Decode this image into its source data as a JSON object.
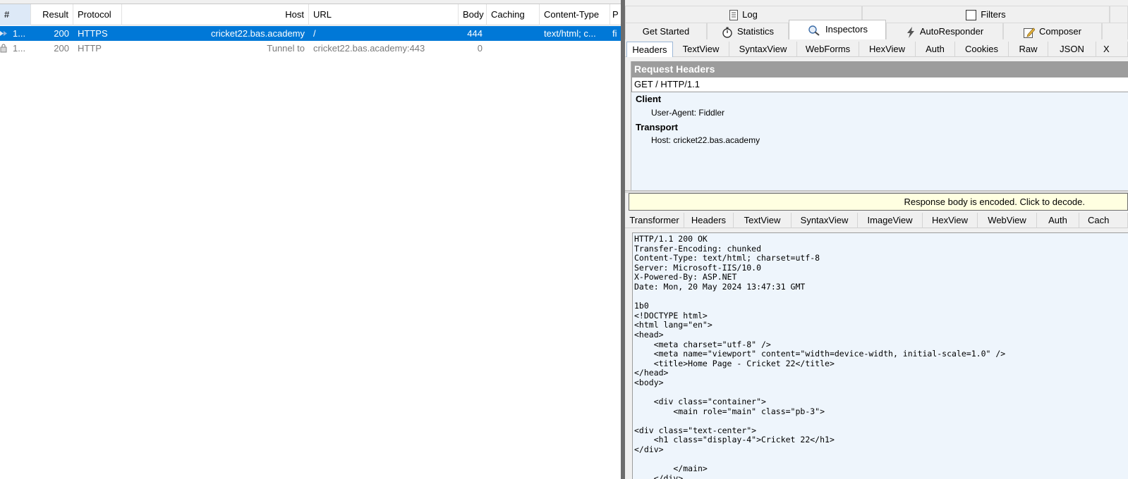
{
  "sessions": {
    "columns": [
      {
        "label": "#"
      },
      {
        "label": "Result"
      },
      {
        "label": "Protocol"
      },
      {
        "label": "Host"
      },
      {
        "label": "URL"
      },
      {
        "label": "Body"
      },
      {
        "label": "Caching"
      },
      {
        "label": "Content-Type"
      },
      {
        "label": "P"
      }
    ],
    "rows": [
      {
        "num": "1...",
        "result": "200",
        "protocol": "HTTPS",
        "host": "cricket22.bas.academy",
        "url": "/",
        "body": "444",
        "caching": "",
        "content_type": "text/html; c...",
        "process": "fi",
        "selected": true
      },
      {
        "num": "1...",
        "result": "200",
        "protocol": "HTTP",
        "host": "Tunnel to",
        "url": "cricket22.bas.academy:443",
        "body": "0",
        "caching": "",
        "content_type": "",
        "process": "",
        "selected": false
      }
    ]
  },
  "top_tabs": {
    "log": "Log",
    "filters": "Filters",
    "get_started": "Get Started",
    "statistics": "Statistics",
    "inspectors": "Inspectors",
    "autoresponder": "AutoResponder",
    "composer": "Composer"
  },
  "request_tabs": [
    "Headers",
    "TextView",
    "SyntaxView",
    "WebForms",
    "HexView",
    "Auth",
    "Cookies",
    "Raw",
    "JSON",
    "X"
  ],
  "request": {
    "title": "Request Headers",
    "request_line": "GET / HTTP/1.1",
    "groups": [
      {
        "name": "Client",
        "headers": [
          "User-Agent: Fiddler"
        ]
      },
      {
        "name": "Transport",
        "headers": [
          "Host: cricket22.bas.academy"
        ]
      }
    ]
  },
  "encoded_bar": "Response body is encoded. Click to decode.",
  "response_tabs": [
    "Transformer",
    "Headers",
    "TextView",
    "SyntaxView",
    "ImageView",
    "HexView",
    "WebView",
    "Auth",
    "Cach"
  ],
  "response_body": "HTTP/1.1 200 OK\nTransfer-Encoding: chunked\nContent-Type: text/html; charset=utf-8\nServer: Microsoft-IIS/10.0\nX-Powered-By: ASP.NET\nDate: Mon, 20 May 2024 13:47:31 GMT\n\n1b0\n<!DOCTYPE html>\n<html lang=\"en\">\n<head>\n    <meta charset=\"utf-8\" />\n    <meta name=\"viewport\" content=\"width=device-width, initial-scale=1.0\" />\n    <title>Home Page - Cricket 22</title>\n</head>\n<body>\n\n    <div class=\"container\">\n        <main role=\"main\" class=\"pb-3\">\n\n<div class=\"text-center\">\n    <h1 class=\"display-4\">Cricket 22</h1>\n</div>\n\n        </main>\n    </div>",
  "colors": {
    "selection": "#0078d7",
    "encoded_bar": "#ffffe1",
    "panel_bg": "#eef5fc",
    "title_bar": "#9c9c9c"
  }
}
